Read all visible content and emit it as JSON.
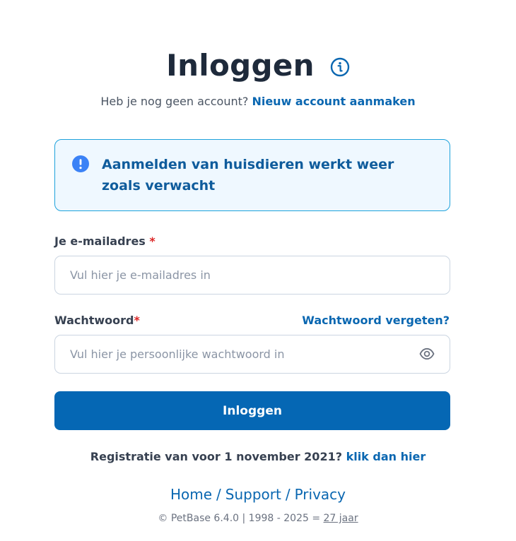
{
  "header": {
    "title": "Inloggen",
    "info_icon": "info-circle-icon",
    "subtitle_prefix": "Heb je nog geen account?",
    "subtitle_link": "Nieuw account aanmaken"
  },
  "alert": {
    "icon": "exclamation-circle-icon",
    "message": "Aanmelden van huisdieren werkt weer zoals verwacht"
  },
  "form": {
    "email": {
      "label": "Je e-mailadres",
      "required_marker": "*",
      "value": "",
      "placeholder": "Vul hier je e-mailadres in"
    },
    "password": {
      "label": "Wachtwoord",
      "required_marker": "*",
      "forgot_link": "Wachtwoord vergeten?",
      "value": "",
      "placeholder": "Vul hier je persoonlijke wachtwoord in",
      "toggle_icon": "eye-icon"
    },
    "submit_label": "Inloggen"
  },
  "legacy": {
    "prefix": "Registratie van voor 1 november 2021?",
    "link": "klik dan hier"
  },
  "footer": {
    "nav": [
      "Home",
      "Support",
      "Privacy"
    ],
    "separator": "/",
    "copyright_prefix": "© PetBase 6.4.0 | 1998 - 2025 =",
    "years": "27 jaar"
  },
  "colors": {
    "accent": "#0567b4",
    "link": "#0a67b1",
    "alert_border": "#1ea2dc",
    "alert_background": "#eff8ff",
    "required": "#dc2626"
  }
}
